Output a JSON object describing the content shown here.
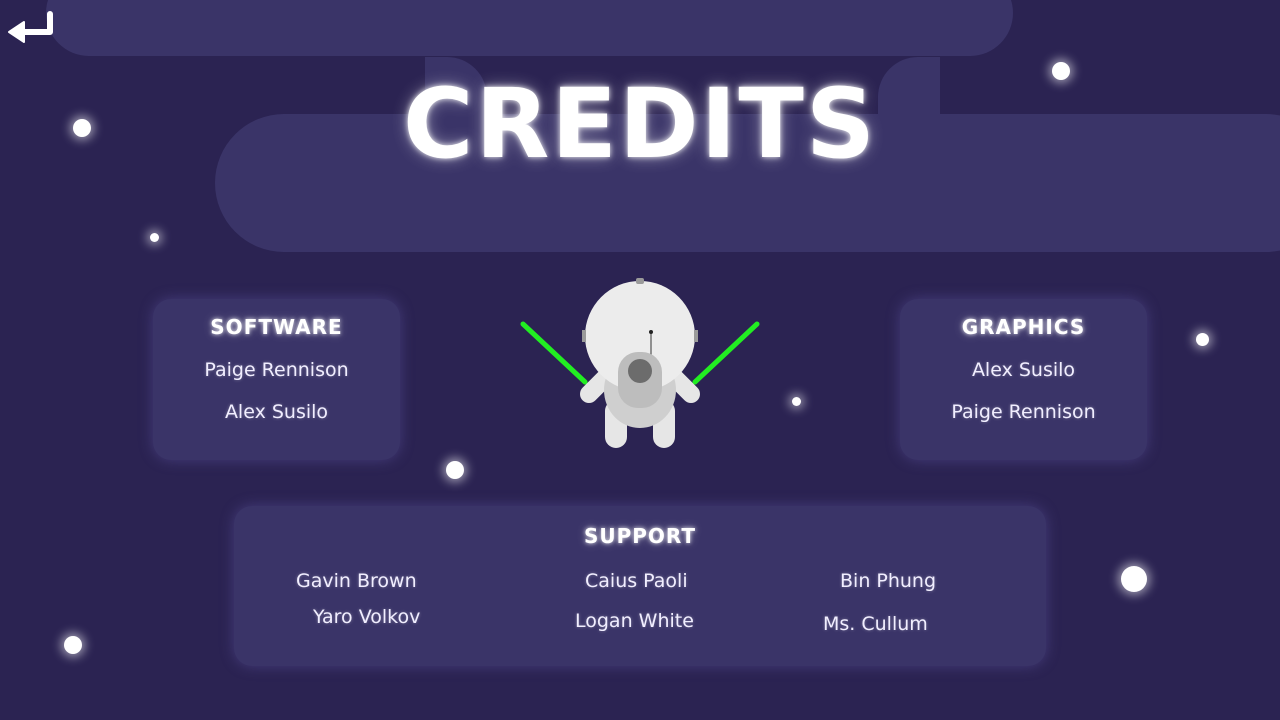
{
  "title": "CREDITS",
  "back_icon": "return-arrow-icon",
  "colors": {
    "background": "#2b2352",
    "panel": "#3a3468",
    "text": "#ffffff",
    "saber": "#22ee22"
  },
  "sections": {
    "software": {
      "title": "SOFTWARE",
      "names": [
        "Paige Rennison",
        "Alex Susilo"
      ]
    },
    "graphics": {
      "title": "GRAPHICS",
      "names": [
        "Alex Susilo",
        "Paige Rennison"
      ]
    },
    "support": {
      "title": "SUPPORT",
      "names": [
        "Gavin Brown",
        "Caius Paoli",
        "Bin Phung",
        "Yaro Volkov",
        "Logan White",
        "Ms. Cullum"
      ]
    }
  }
}
